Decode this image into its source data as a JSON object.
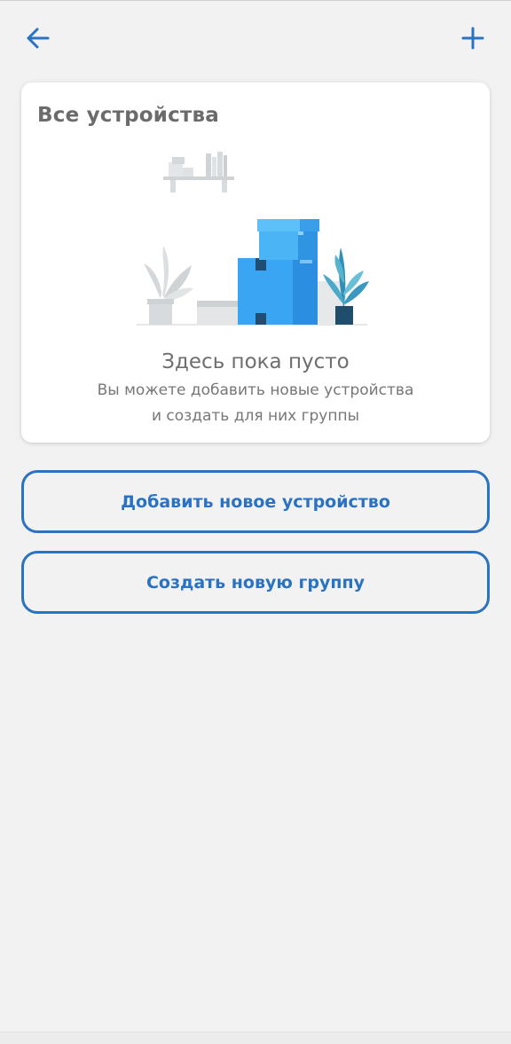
{
  "header": {
    "back_icon": "arrow-left-icon",
    "add_icon": "plus-icon"
  },
  "card": {
    "title": "Все устройства",
    "illustration_icon": "empty-boxes-illustration",
    "empty_title": "Здесь пока пусто",
    "empty_subtitle_line1": "Вы можете добавить новые устройства",
    "empty_subtitle_line2": "и создать для них группы"
  },
  "actions": {
    "add_device_label": "Добавить новое устройство",
    "create_group_label": "Создать новую группу"
  },
  "colors": {
    "accent": "#2a72c2",
    "background": "#f2f2f2",
    "card": "#ffffff",
    "title_text": "#6b6b6b",
    "box_blue": "#3aa0f0"
  }
}
